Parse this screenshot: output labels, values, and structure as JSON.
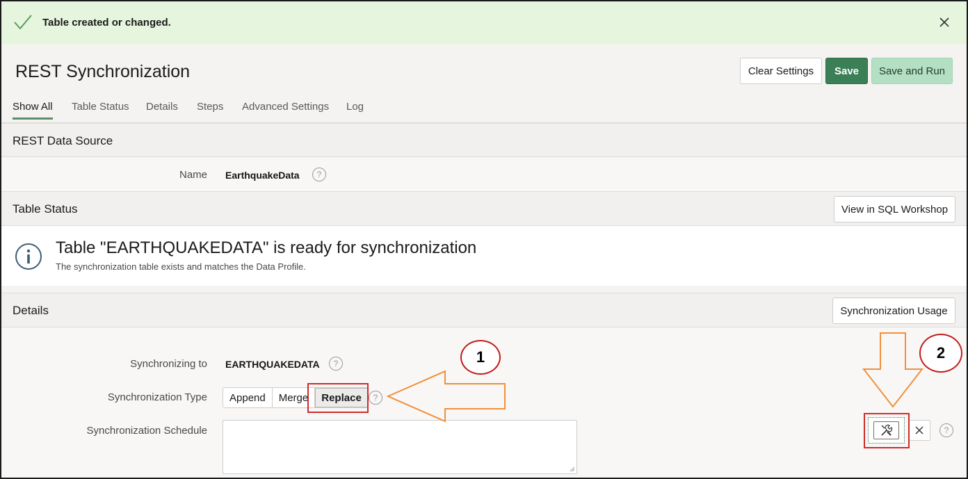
{
  "banner": {
    "message": "Table created or changed."
  },
  "header": {
    "title": "REST Synchronization",
    "buttons": {
      "clear": "Clear Settings",
      "save": "Save",
      "save_run": "Save and Run"
    }
  },
  "tabs": [
    "Show All",
    "Table Status",
    "Details",
    "Steps",
    "Advanced Settings",
    "Log"
  ],
  "rest_data_source": {
    "heading": "REST Data Source",
    "name_label": "Name",
    "name_value": "EarthquakeData"
  },
  "table_status": {
    "heading": "Table Status",
    "button": "View in SQL Workshop",
    "title": "Table \"EARTHQUAKEDATA\" is ready for synchronization",
    "subtitle": "The synchronization table exists and matches the Data Profile."
  },
  "details": {
    "heading": "Details",
    "button": "Synchronization Usage",
    "sync_to_label": "Synchronizing to",
    "sync_to_value": "EARTHQUAKEDATA",
    "sync_type_label": "Synchronization Type",
    "sync_type_options": [
      "Append",
      "Merge",
      "Replace"
    ],
    "sync_type_selected": "Replace",
    "schedule_label": "Synchronization Schedule"
  },
  "help_glyph": "?",
  "annotations": {
    "one": "1",
    "two": "2"
  },
  "colors": {
    "banner_bg": "#e6f5dd",
    "save_green": "#3a7f55",
    "save_run_bg": "#b4dfc3",
    "annotation_red": "#d12a2a",
    "arrow_orange": "#f0903a"
  },
  "icons": [
    "checkmark-icon",
    "close-icon",
    "info-icon",
    "wrench-screwdriver-icon",
    "clear-x-icon",
    "help-icon"
  ]
}
